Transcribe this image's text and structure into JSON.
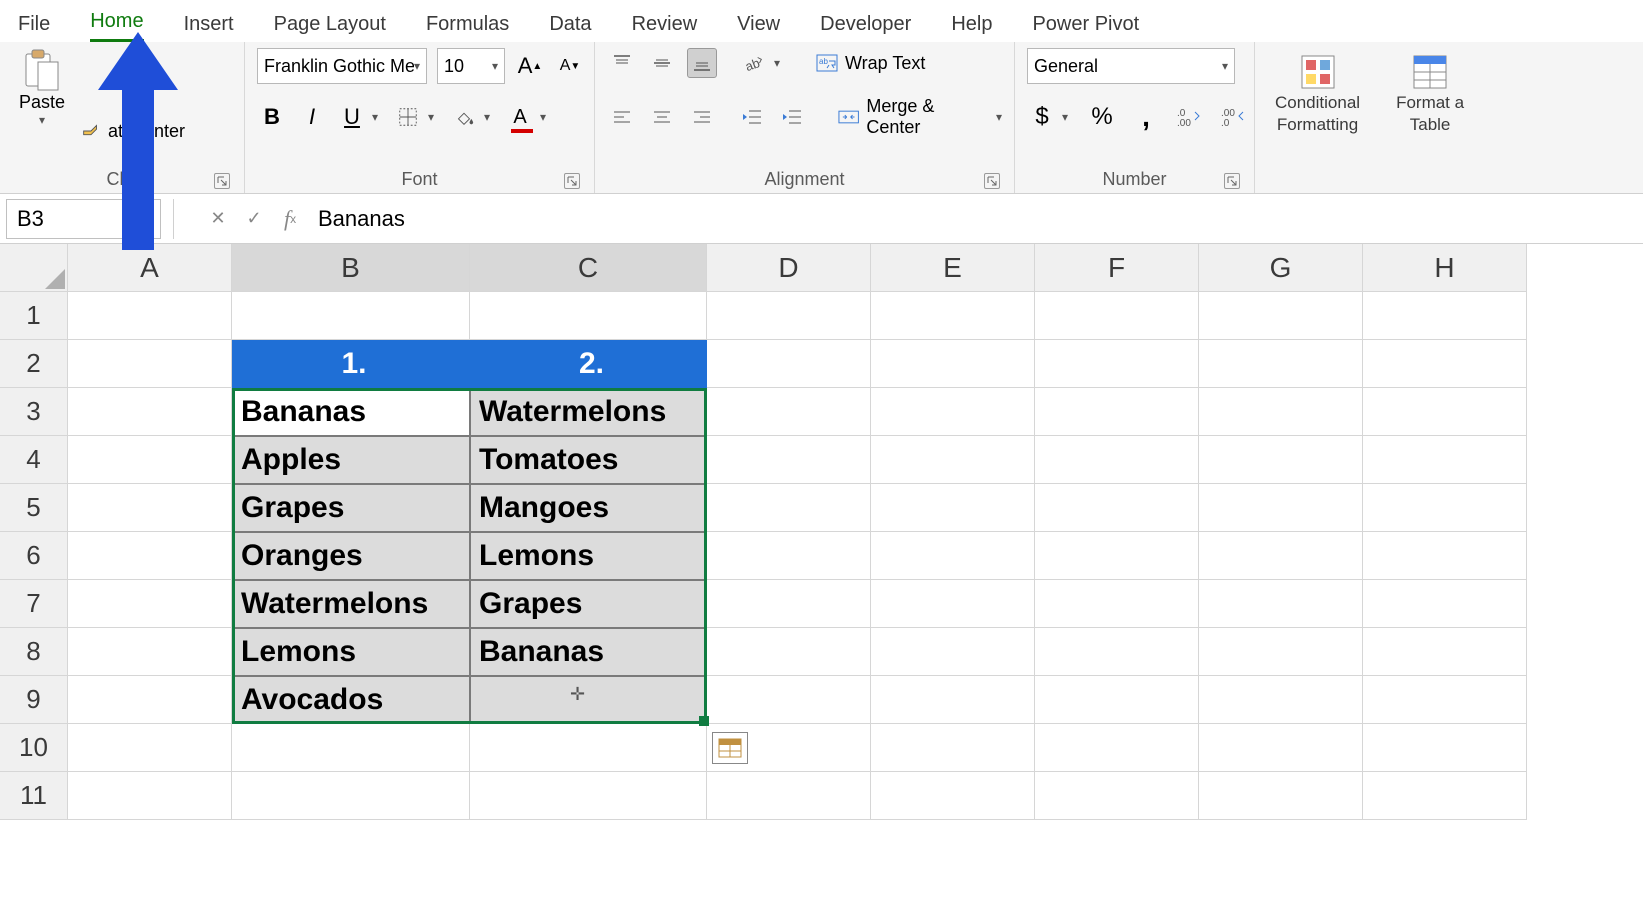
{
  "tabs": {
    "items": [
      "File",
      "Home",
      "Insert",
      "Page Layout",
      "Formulas",
      "Data",
      "Review",
      "View",
      "Developer",
      "Help",
      "Power Pivot"
    ],
    "active": "Home"
  },
  "ribbon": {
    "clipboard": {
      "paste": "Paste",
      "format_painter": "at Painter",
      "label": "Clip"
    },
    "font": {
      "name": "Franklin Gothic Me",
      "size": "10",
      "label": "Font"
    },
    "alignment": {
      "wrap": "Wrap Text",
      "merge": "Merge & Center",
      "label": "Alignment"
    },
    "number": {
      "format": "General",
      "label": "Number"
    },
    "styles": {
      "cond": "Conditional\nFormatting",
      "fmt_table": "Format a\nTable"
    }
  },
  "formula_bar": {
    "namebox": "B3",
    "formula": "Bananas"
  },
  "sheet": {
    "columns": [
      "A",
      "B",
      "C",
      "D",
      "E",
      "F",
      "G",
      "H"
    ],
    "rows": [
      "1",
      "2",
      "3",
      "4",
      "5",
      "6",
      "7",
      "8",
      "9",
      "10",
      "11"
    ],
    "selected_cols": [
      "B",
      "C"
    ],
    "table": {
      "headers": [
        "1.",
        "2."
      ],
      "col1": [
        "Bananas",
        "Apples",
        "Grapes",
        "Oranges",
        "Watermelons",
        "Lemons",
        "Avocados"
      ],
      "col2": [
        "Watermelons",
        "Tomatoes",
        "Mangoes",
        "Lemons",
        "Grapes",
        "Bananas",
        ""
      ]
    }
  }
}
